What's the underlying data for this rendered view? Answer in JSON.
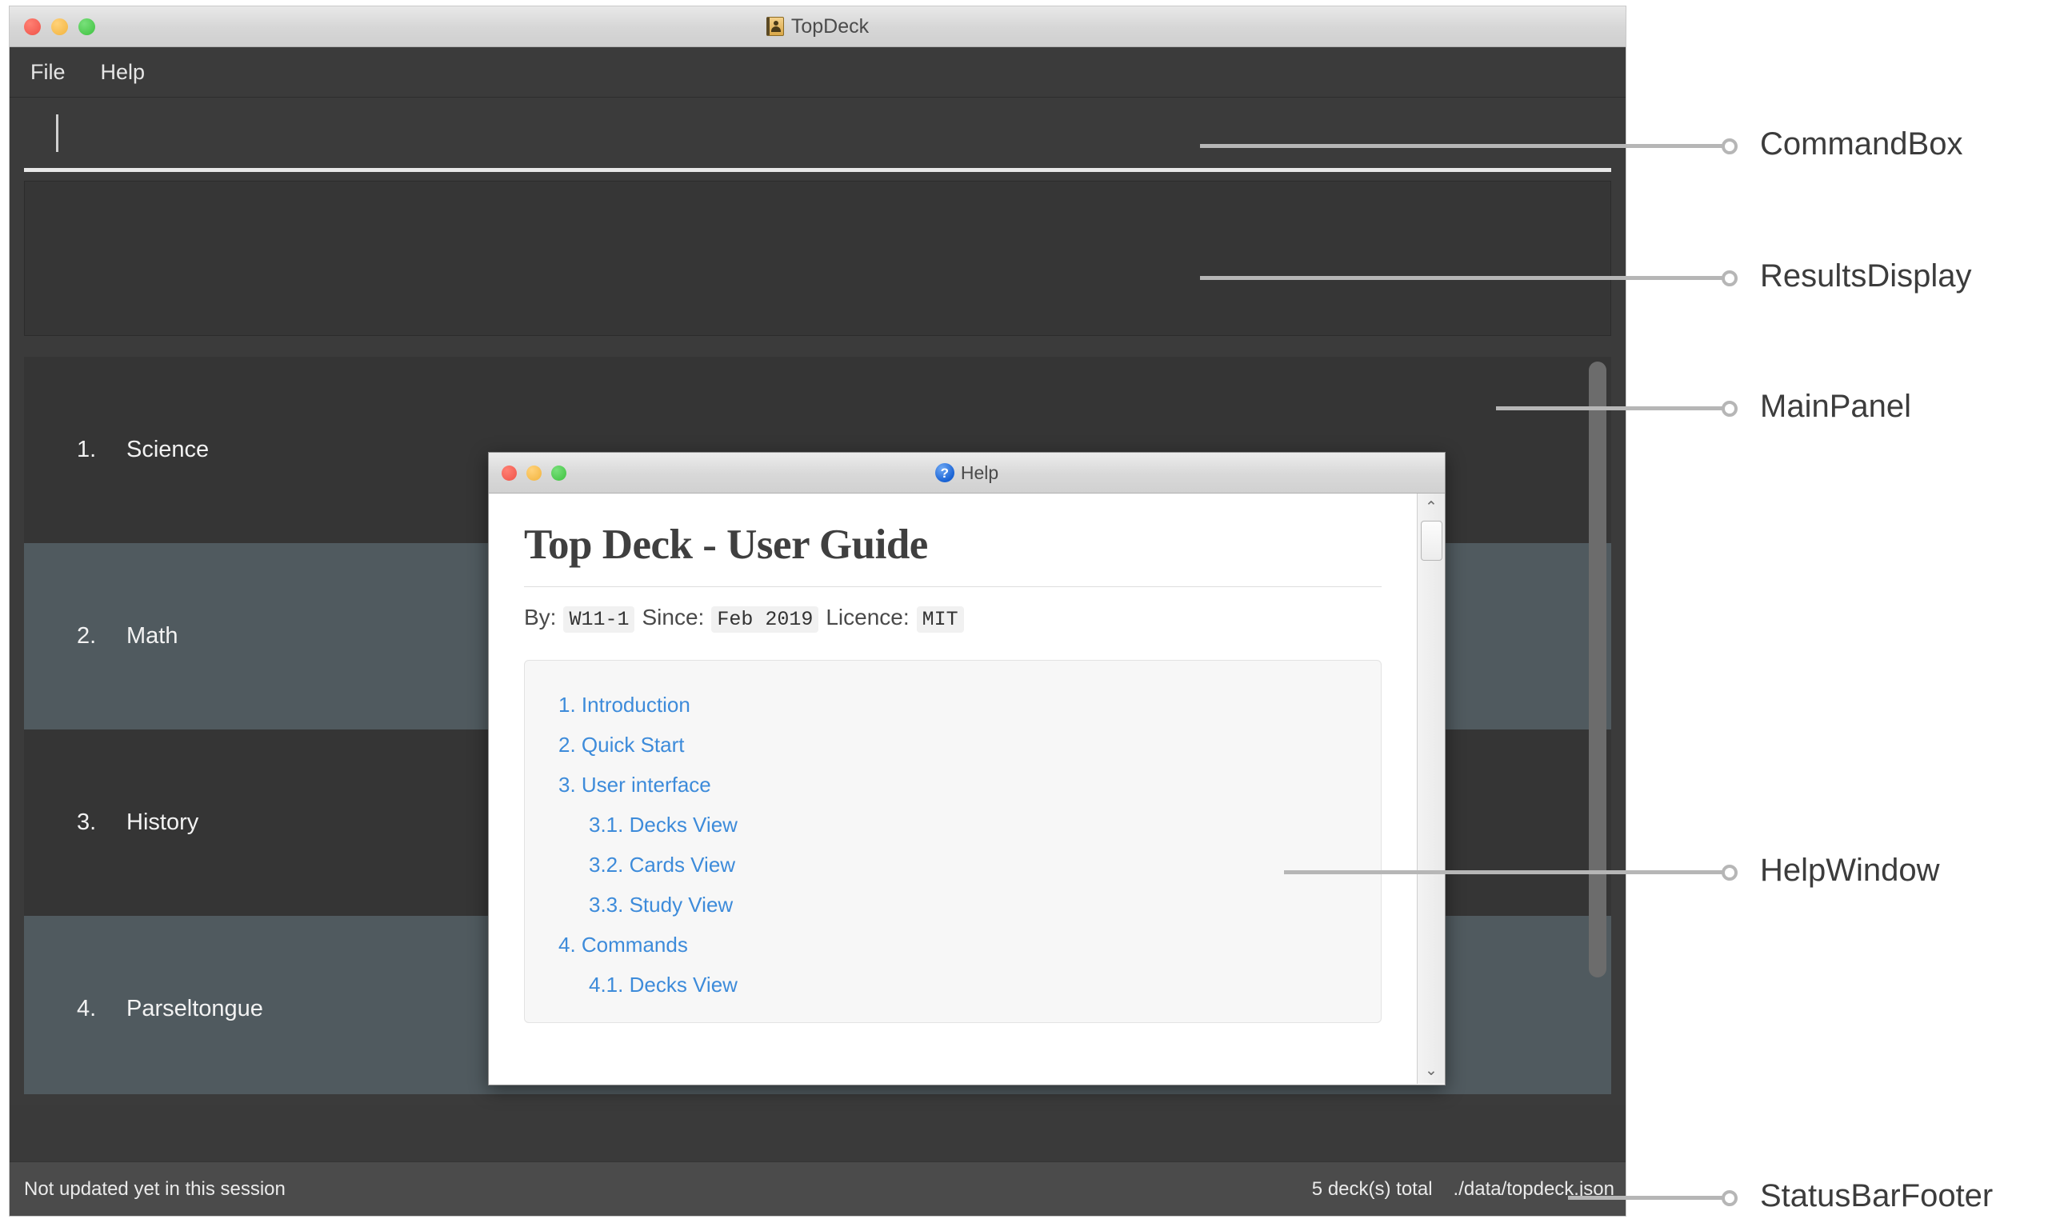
{
  "app": {
    "title": "TopDeck",
    "icon": "address-book-icon",
    "menu": [
      {
        "label": "File"
      },
      {
        "label": "Help"
      }
    ],
    "command_box": {
      "value": "",
      "placeholder": ""
    },
    "results_display": {
      "text": ""
    },
    "decks": [
      {
        "index": "1.",
        "name": "Science"
      },
      {
        "index": "2.",
        "name": "Math"
      },
      {
        "index": "3.",
        "name": "History"
      },
      {
        "index": "4.",
        "name": "Parseltongue"
      }
    ],
    "status_bar": {
      "left": "Not updated yet in this session",
      "count": "5 deck(s) total",
      "path": "./data/topdeck.json"
    }
  },
  "help_window": {
    "title": "Help",
    "icon": "question-mark-icon",
    "doc_title": "Top Deck - User Guide",
    "meta": {
      "by_label": "By:",
      "by_value": "W11-1",
      "since_label": "Since:",
      "since_value": "Feb 2019",
      "licence_label": "Licence:",
      "licence_value": "MIT"
    },
    "toc": [
      {
        "label": "1. Introduction",
        "level": 1
      },
      {
        "label": "2. Quick Start",
        "level": 1
      },
      {
        "label": "3. User interface",
        "level": 1
      },
      {
        "label": "3.1. Decks View",
        "level": 2
      },
      {
        "label": "3.2. Cards View",
        "level": 2
      },
      {
        "label": "3.3. Study View",
        "level": 2
      },
      {
        "label": "4. Commands",
        "level": 1
      },
      {
        "label": "4.1. Decks View",
        "level": 2
      }
    ],
    "scroll_up_glyph": "⌃",
    "scroll_down_glyph": "⌄"
  },
  "annotations": [
    {
      "label": "CommandBox"
    },
    {
      "label": "ResultsDisplay"
    },
    {
      "label": "MainPanel"
    },
    {
      "label": "HelpWindow"
    },
    {
      "label": "StatusBarFooter"
    }
  ],
  "colors": {
    "window_chrome": "#3b3b3b",
    "row_alt": "#505a5f",
    "link": "#3d8bda",
    "annotation": "#b6b6b6"
  }
}
